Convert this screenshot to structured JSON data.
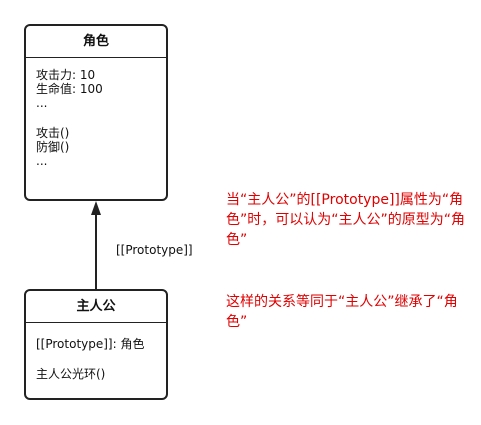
{
  "colors": {
    "box_border": "#222222",
    "note_text": "#e00000",
    "text": "#111111"
  },
  "role_class": {
    "title": "角色",
    "attributes": [
      "攻击力: 10",
      "生命值: 100",
      "..."
    ],
    "methods": [
      "攻击()",
      "防御()",
      "..."
    ]
  },
  "hero_class": {
    "title": "主人公",
    "attributes": [
      "[[Prototype]]: 角色"
    ],
    "methods": [
      "主人公光环()"
    ]
  },
  "edge": {
    "label": "[[Prototype]]",
    "arrowhead": "filled-triangle"
  },
  "notes": {
    "prototype_note": "当“主人公”的[[Prototype]]属性为“角色”时，可以认为“主人公”的原型为“角色”",
    "inheritance_note": "这样的关系等同于“主人公”继承了“角色”"
  }
}
